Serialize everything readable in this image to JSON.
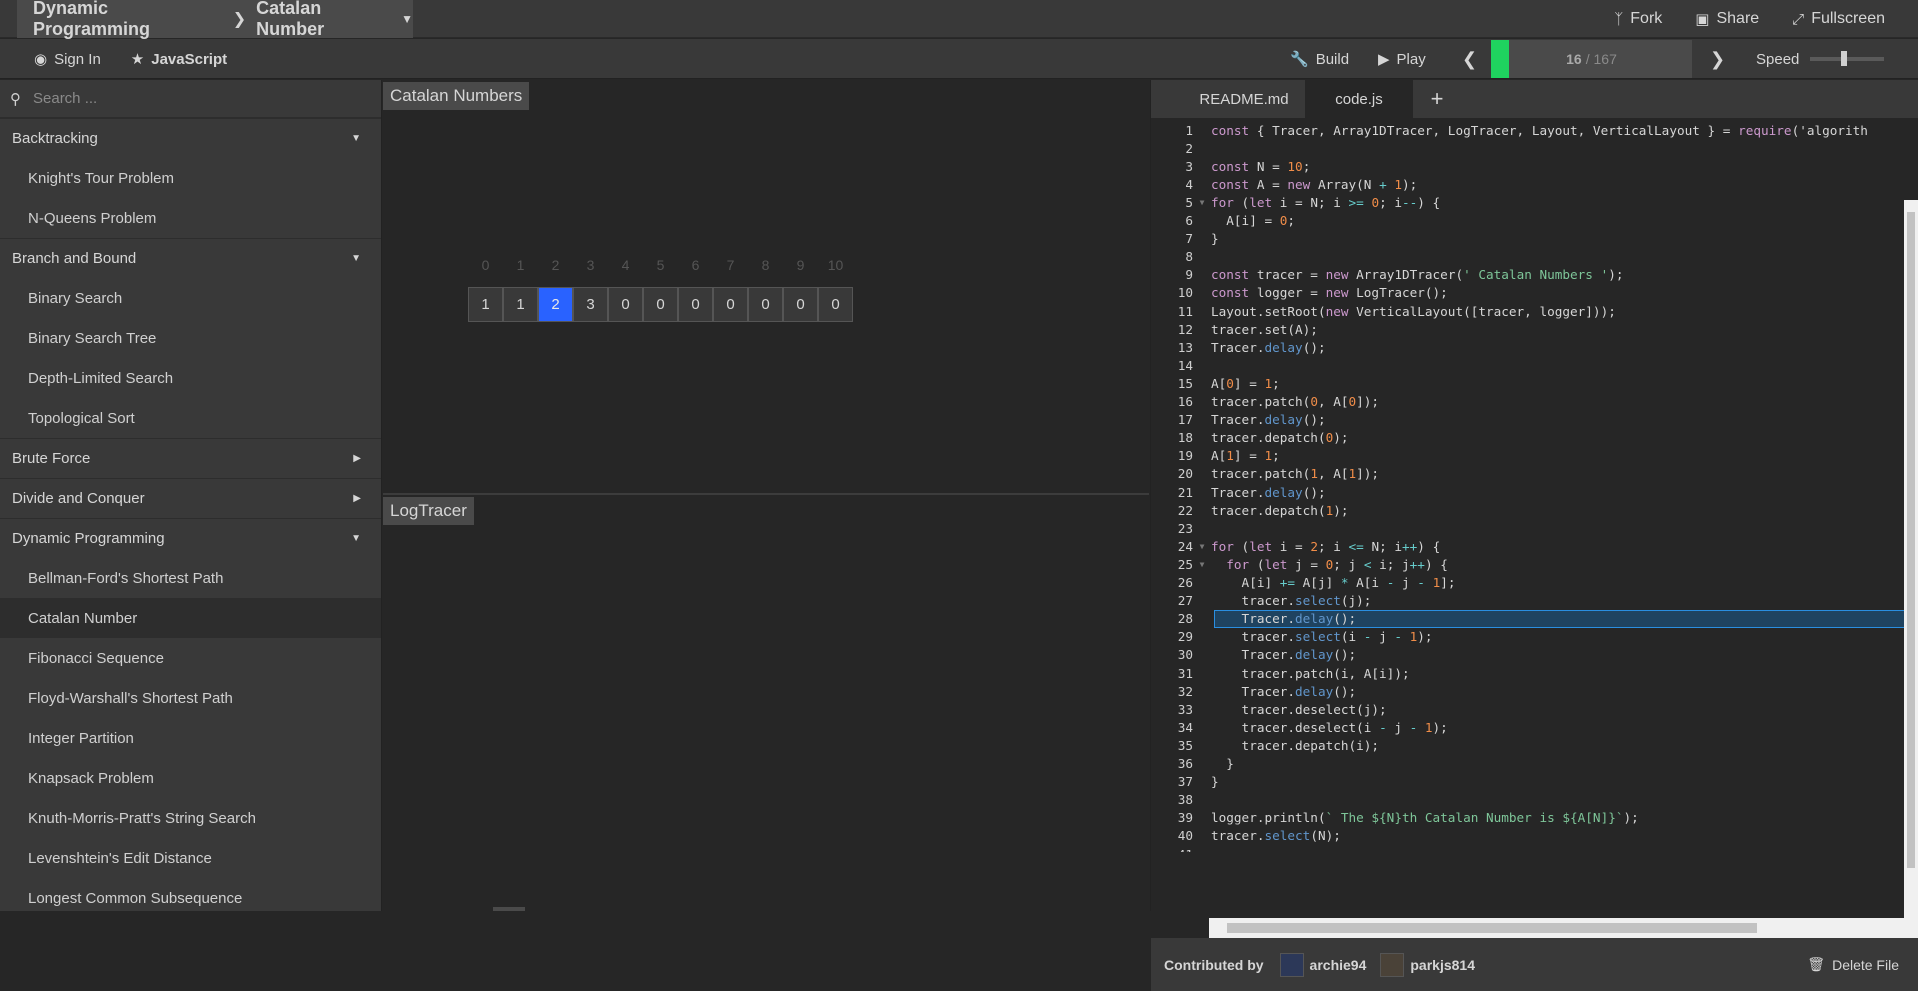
{
  "header": {
    "category": "Dynamic Programming",
    "algorithm": "Catalan Number",
    "fork": "Fork",
    "share": "Share",
    "fullscreen": "Fullscreen"
  },
  "toolbar": {
    "sign_in": "Sign In",
    "language": "JavaScript",
    "build": "Build",
    "play": "Play",
    "step_current": "16",
    "step_total": "/ 167",
    "step_fraction": 0.096,
    "speed_label": "Speed",
    "speed_level": 0.42
  },
  "sidebar": {
    "search_placeholder": "Search ...",
    "items": [
      {
        "type": "cat",
        "label": "Backtracking",
        "open": true
      },
      {
        "type": "algo",
        "label": "Knight's Tour Problem"
      },
      {
        "type": "algo",
        "label": "N-Queens Problem"
      },
      {
        "type": "cat",
        "label": "Branch and Bound",
        "open": true
      },
      {
        "type": "algo",
        "label": "Binary Search"
      },
      {
        "type": "algo",
        "label": "Binary Search Tree"
      },
      {
        "type": "algo",
        "label": "Depth-Limited Search"
      },
      {
        "type": "algo",
        "label": "Topological Sort"
      },
      {
        "type": "cat",
        "label": "Brute Force",
        "open": false
      },
      {
        "type": "cat",
        "label": "Divide and Conquer",
        "open": false
      },
      {
        "type": "cat",
        "label": "Dynamic Programming",
        "open": true
      },
      {
        "type": "algo",
        "label": "Bellman-Ford's Shortest Path"
      },
      {
        "type": "algo",
        "label": "Catalan Number",
        "active": true
      },
      {
        "type": "algo",
        "label": "Fibonacci Sequence"
      },
      {
        "type": "algo",
        "label": "Floyd-Warshall's Shortest Path"
      },
      {
        "type": "algo",
        "label": "Integer Partition"
      },
      {
        "type": "algo",
        "label": "Knapsack Problem"
      },
      {
        "type": "algo",
        "label": "Knuth-Morris-Pratt's String Search"
      },
      {
        "type": "algo",
        "label": "Levenshtein's Edit Distance"
      },
      {
        "type": "algo",
        "label": "Longest Common Subsequence"
      }
    ]
  },
  "visualizer": {
    "array_title": "Catalan Numbers",
    "log_title": "LogTracer",
    "indices": [
      "0",
      "1",
      "2",
      "3",
      "4",
      "5",
      "6",
      "7",
      "8",
      "9",
      "10"
    ],
    "values": [
      "1",
      "1",
      "2",
      "3",
      "0",
      "0",
      "0",
      "0",
      "0",
      "0",
      "0"
    ],
    "selected_index": 2
  },
  "editor": {
    "tabs": [
      "README.md",
      "code.js",
      "+"
    ],
    "active_tab": 1,
    "highlight_line": 28,
    "lines": [
      "const { Tracer, Array1DTracer, LogTracer, Layout, VerticalLayout } = require('algorith",
      "",
      "const N = 10;",
      "const A = new Array(N + 1);",
      "for (let i = N; i >= 0; i--) {",
      "  A[i] = 0;",
      "}",
      "",
      "const tracer = new Array1DTracer(' Catalan Numbers ');",
      "const logger = new LogTracer();",
      "Layout.setRoot(new VerticalLayout([tracer, logger]));",
      "tracer.set(A);",
      "Tracer.delay();",
      "",
      "A[0] = 1;",
      "tracer.patch(0, A[0]);",
      "Tracer.delay();",
      "tracer.depatch(0);",
      "A[1] = 1;",
      "tracer.patch(1, A[1]);",
      "Tracer.delay();",
      "tracer.depatch(1);",
      "",
      "for (let i = 2; i <= N; i++) {",
      "  for (let j = 0; j < i; j++) {",
      "    A[i] += A[j] * A[i - j - 1];",
      "    tracer.select(j);",
      "    Tracer.delay();",
      "    tracer.select(i - j - 1);",
      "    Tracer.delay();",
      "    tracer.patch(i, A[i]);",
      "    Tracer.delay();",
      "    tracer.deselect(j);",
      "    tracer.deselect(i - j - 1);",
      "    tracer.depatch(i);",
      "  }",
      "}",
      "",
      "logger.println(` The ${N}th Catalan Number is ${A[N]}`);",
      "tracer.select(N);",
      ""
    ],
    "fold_lines": [
      5,
      24,
      25
    ]
  },
  "footer": {
    "contributed_by": "Contributed by",
    "contributors": [
      "archie94",
      "parkjs814"
    ],
    "delete": "Delete File"
  }
}
